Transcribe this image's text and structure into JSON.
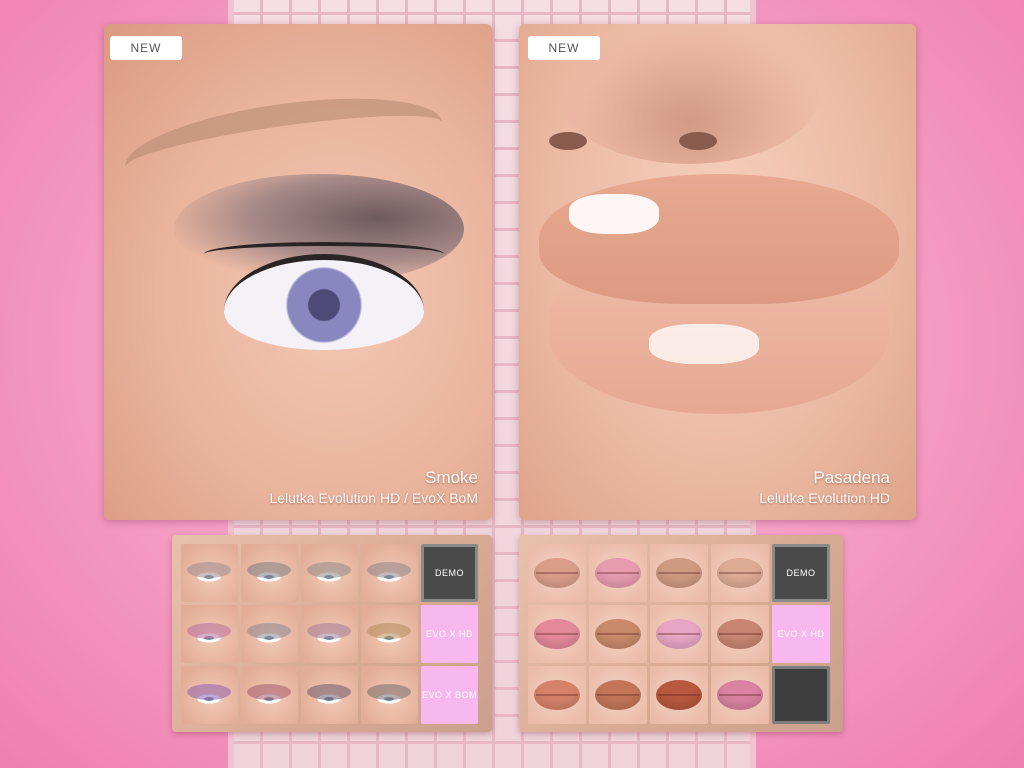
{
  "cards": [
    {
      "badge": "NEW",
      "title": "Smoke",
      "subtitle": "Lelutka Evolution HD / EvoX BoM"
    },
    {
      "badge": "NEW",
      "title": "Pasadena",
      "subtitle": "Lelutka Evolution HD"
    }
  ],
  "eye_panel": {
    "buttons": [
      "DEMO",
      "EVO X HD",
      "EVO X BOM"
    ],
    "swatch_shadows": [
      "#9c8a8e",
      "#7d7c82",
      "#8e8a86",
      "#8c8386",
      "#b86c9e",
      "#8c8590",
      "#a07b98",
      "#b18a58",
      "#8e5fae",
      "#a05a6e",
      "#6d5a6e",
      "#756c6a"
    ]
  },
  "lip_panel": {
    "buttons": [
      "DEMO",
      "EVO X HD",
      ""
    ],
    "swatch_lips": [
      "#d99f8b",
      "#e79cb0",
      "#cf9a82",
      "#ddab96",
      "#e3899a",
      "#c98a6a",
      "#e7a6c4",
      "#c98573",
      "#d6826a",
      "#c27657",
      "#b8583e",
      "#d982a2"
    ]
  }
}
